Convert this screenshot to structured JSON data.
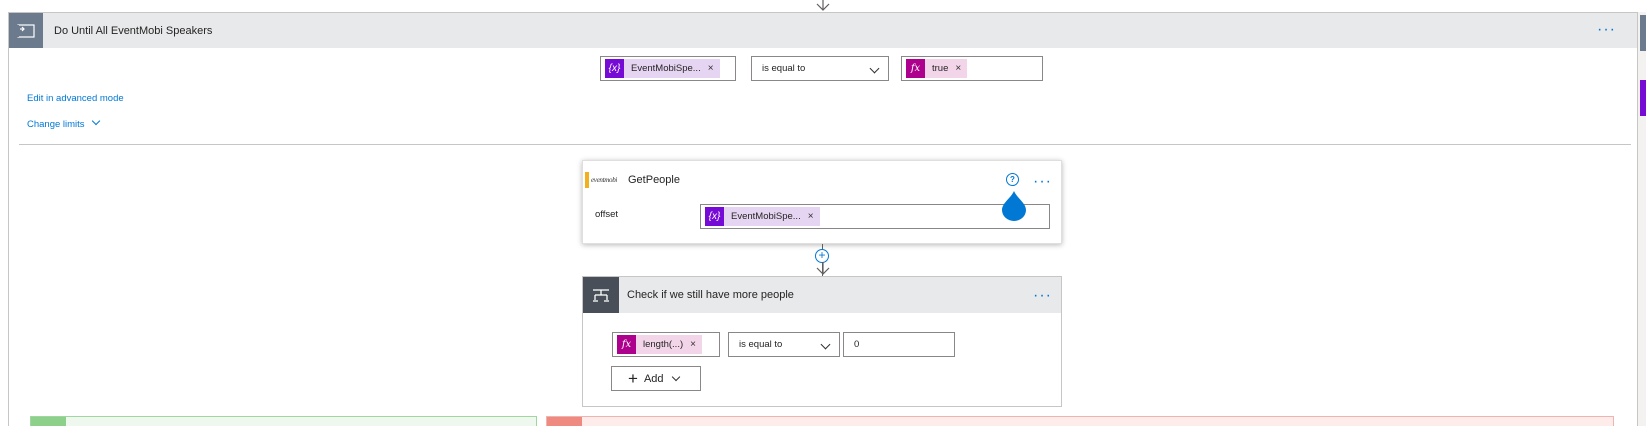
{
  "until": {
    "title": "Do Until All EventMobi Speakers",
    "condition": {
      "left_token": "EventMobiSpe...",
      "operator": "is equal to",
      "right_token": "true"
    },
    "advanced_link": "Edit in advanced mode",
    "limits_link": "Change limits"
  },
  "get_people": {
    "title": "GetPeople",
    "logo_text": "eventmobi",
    "help_glyph": "?",
    "offset_label": "offset",
    "offset_token": "EventMobiSpe..."
  },
  "check": {
    "title": "Check if we still have more people",
    "left_token": "length(...)",
    "operator": "is equal to",
    "value": "0",
    "add_label": "Add"
  },
  "glyphs": {
    "remove": "×",
    "more": "···",
    "insert": "+",
    "plus": "+",
    "var_icon": "{x}",
    "fx_icon": "fx"
  },
  "colors": {
    "accent": "#0078d4",
    "variable": "#770bd6",
    "expression": "#ad008c",
    "header_bg": "#e8e9eb",
    "yes_branch": "#8cd08c",
    "no_branch": "#ef8a80"
  }
}
